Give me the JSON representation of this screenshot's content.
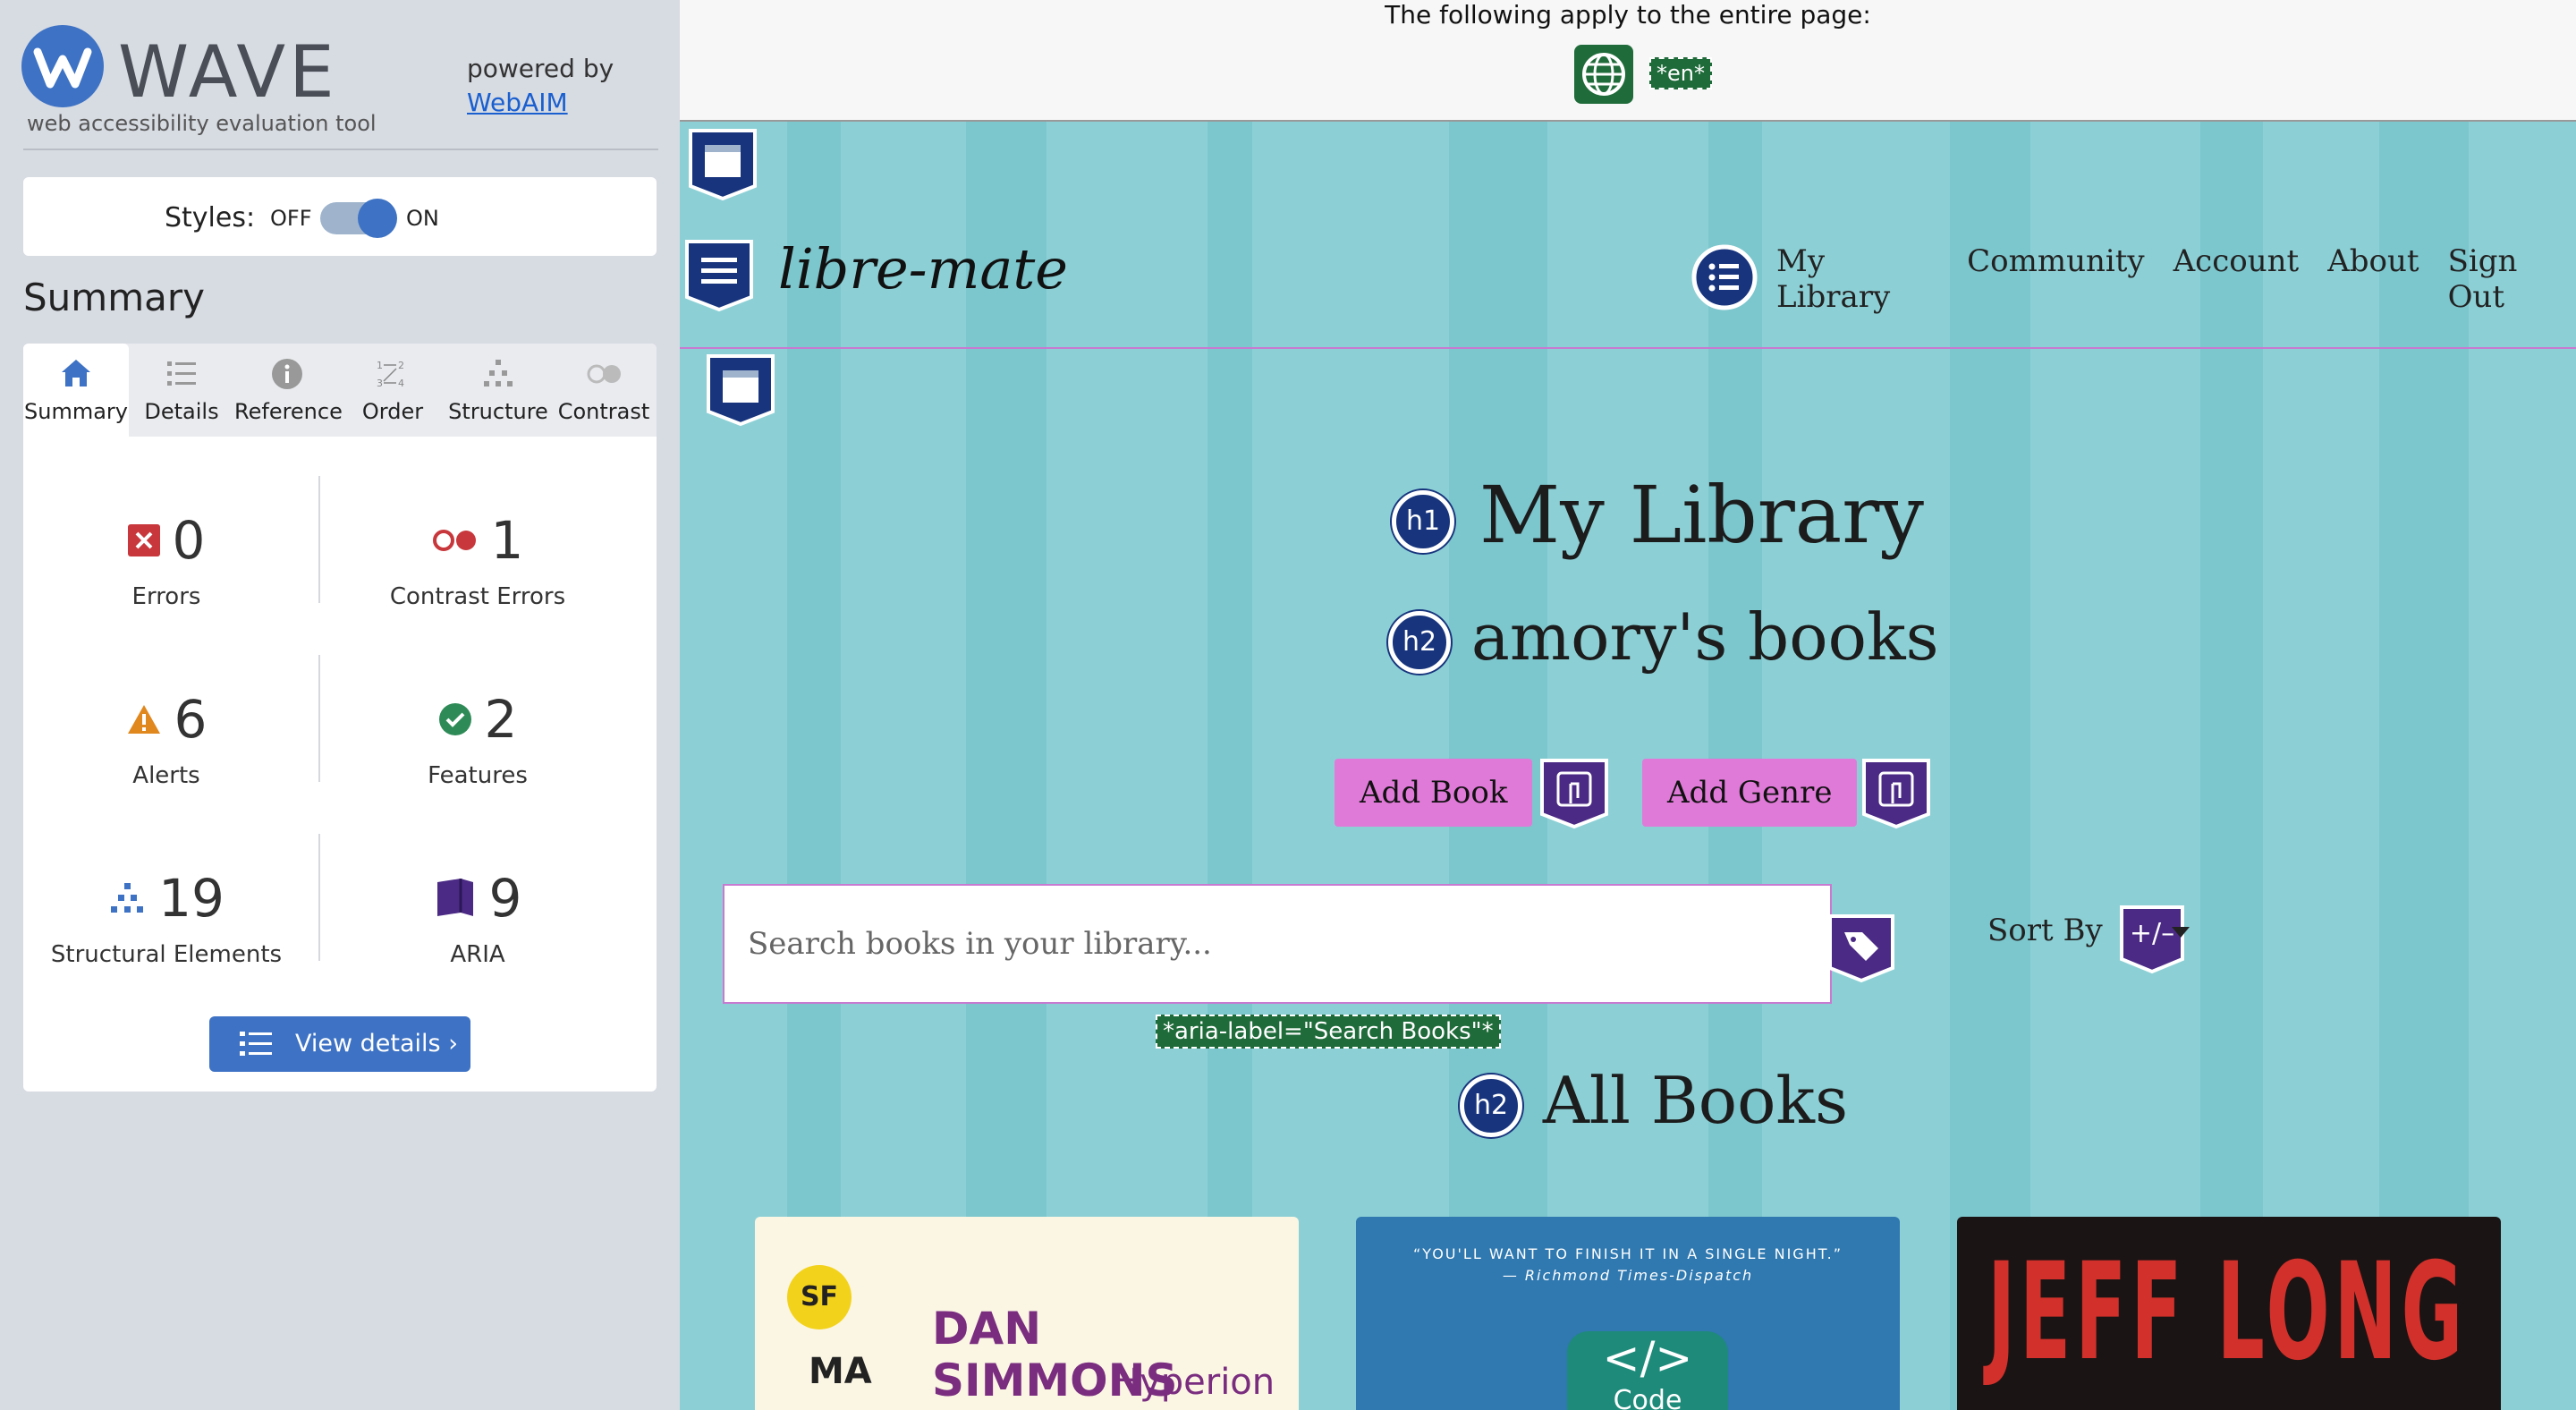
{
  "wave": {
    "title": "WAVE",
    "subtitle": "web accessibility evaluation tool",
    "powered_by": "powered by",
    "webaim_link": "WebAIM",
    "styles_label": "Styles:",
    "styles_off": "OFF",
    "styles_on": "ON",
    "summary_heading": "Summary",
    "tabs": [
      {
        "label": "Summary",
        "icon": "home-icon",
        "active": true
      },
      {
        "label": "Details",
        "icon": "list-icon",
        "active": false
      },
      {
        "label": "Reference",
        "icon": "info-icon",
        "active": false
      },
      {
        "label": "Order",
        "icon": "order-icon",
        "active": false
      },
      {
        "label": "Structure",
        "icon": "structure-icon",
        "active": false
      },
      {
        "label": "Contrast",
        "icon": "contrast-icon",
        "active": false
      }
    ],
    "stats": {
      "errors": {
        "count": "0",
        "label": "Errors"
      },
      "contrast_errors": {
        "count": "1",
        "label": "Contrast Errors"
      },
      "alerts": {
        "count": "6",
        "label": "Alerts"
      },
      "features": {
        "count": "2",
        "label": "Features"
      },
      "structural": {
        "count": "19",
        "label": "Structural Elements"
      },
      "aria": {
        "count": "9",
        "label": "ARIA"
      }
    },
    "view_details": "View details ›",
    "colors": {
      "accent": "#3d72c4",
      "error": "#c8373b",
      "alert": "#e0871e",
      "feature": "#2e8b57",
      "aria": "#4b2a85"
    }
  },
  "page": {
    "banner_text": "The following apply to the entire page:",
    "lang_tag": "*en*",
    "site_logo": "libre-mate",
    "nav": [
      "My Library",
      "Community",
      "Account",
      "About",
      "Sign Out"
    ],
    "h1_badge": "h1",
    "h1": "My Library",
    "h2_badge": "h2",
    "h2_user": "amory's books",
    "buttons": {
      "add_book": "Add Book",
      "add_genre": "Add Genre"
    },
    "search_placeholder": "Search books in your library...",
    "aria_label_tag": "*aria-label=\"Search Books\"*",
    "sort_label": "Sort By",
    "sort_badge": "+/–",
    "h2_all": "All Books",
    "books": [
      {
        "badge": "SF",
        "spine": "MA",
        "author": "DAN SIMMONS",
        "title": "Hyperion"
      },
      {
        "quote": "“YOU'LL WANT TO FINISH IT IN A SINGLE NIGHT.”",
        "quote_source": "— Richmond Times-Dispatch",
        "code_symbol": "</>",
        "code_label": "Code"
      },
      {
        "author": "JEFF LONG"
      }
    ],
    "colors": {
      "background": "#8cd0d6",
      "button": "#e07ad8",
      "heading_badge": "#17347d",
      "wave_green": "#1f6b3a"
    }
  }
}
